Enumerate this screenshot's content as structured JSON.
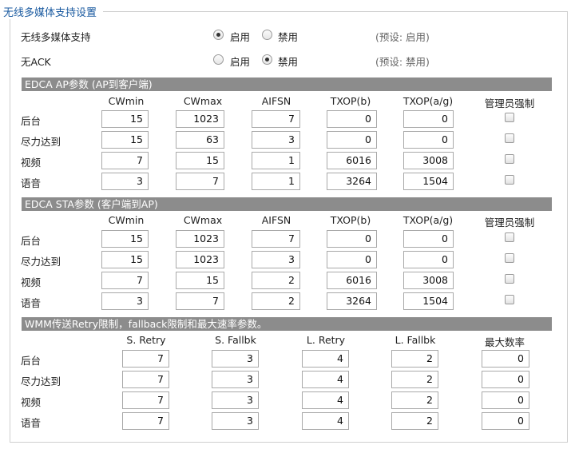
{
  "title": "无线多媒体支持设置",
  "wmm": {
    "label": "无线多媒体支持",
    "on_label": "启用",
    "off_label": "禁用",
    "selected": "on",
    "default_note": "(预设: 启用)"
  },
  "noack": {
    "label": "无ACK",
    "on_label": "启用",
    "off_label": "禁用",
    "selected": "off",
    "default_note": "(预设: 禁用)"
  },
  "edca_ap": {
    "title": "EDCA AP参数 (AP到客户端)",
    "headers": [
      "CWmin",
      "CWmax",
      "AIFSN",
      "TXOP(b)",
      "TXOP(a/g)",
      "管理员强制"
    ],
    "rows": [
      {
        "label": "后台",
        "values": [
          "15",
          "1023",
          "7",
          "0",
          "0"
        ],
        "admin": false
      },
      {
        "label": "尽力达到",
        "values": [
          "15",
          "63",
          "3",
          "0",
          "0"
        ],
        "admin": false
      },
      {
        "label": "视频",
        "values": [
          "7",
          "15",
          "1",
          "6016",
          "3008"
        ],
        "admin": false
      },
      {
        "label": "语音",
        "values": [
          "3",
          "7",
          "1",
          "3264",
          "1504"
        ],
        "admin": false
      }
    ]
  },
  "edca_sta": {
    "title": "EDCA STA参数 (客户端到AP)",
    "headers": [
      "CWmin",
      "CWmax",
      "AIFSN",
      "TXOP(b)",
      "TXOP(a/g)",
      "管理员强制"
    ],
    "rows": [
      {
        "label": "后台",
        "values": [
          "15",
          "1023",
          "7",
          "0",
          "0"
        ],
        "admin": false
      },
      {
        "label": "尽力达到",
        "values": [
          "15",
          "1023",
          "3",
          "0",
          "0"
        ],
        "admin": false
      },
      {
        "label": "视频",
        "values": [
          "7",
          "15",
          "2",
          "6016",
          "3008"
        ],
        "admin": false
      },
      {
        "label": "语音",
        "values": [
          "3",
          "7",
          "2",
          "3264",
          "1504"
        ],
        "admin": false
      }
    ]
  },
  "wmm_retry": {
    "title": "WMM传送Retry限制，fallback限制和最大速率参数。",
    "headers": [
      "S. Retry",
      "S. Fallbk",
      "L. Retry",
      "L. Fallbk",
      "最大数率"
    ],
    "rows": [
      {
        "label": "后台",
        "values": [
          "7",
          "3",
          "4",
          "2",
          "0"
        ]
      },
      {
        "label": "尽力达到",
        "values": [
          "7",
          "3",
          "4",
          "2",
          "0"
        ]
      },
      {
        "label": "视频",
        "values": [
          "7",
          "3",
          "4",
          "2",
          "0"
        ]
      },
      {
        "label": "语音",
        "values": [
          "7",
          "3",
          "4",
          "2",
          "0"
        ]
      }
    ]
  }
}
